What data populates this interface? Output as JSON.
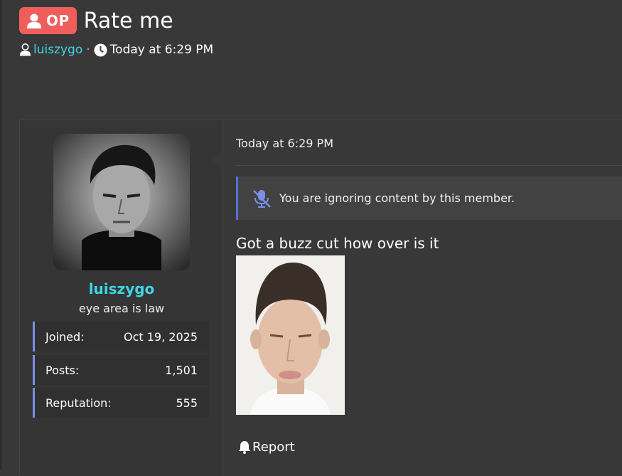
{
  "thread": {
    "badge": "OP",
    "title": "Rate me",
    "author": "luiszygo",
    "separator": "·",
    "date": "Today at 6:29 PM"
  },
  "post": {
    "user": {
      "name": "luiszygo",
      "title": "eye area is law",
      "stats": [
        {
          "label": "Joined:",
          "value": "Oct 19, 2025"
        },
        {
          "label": "Posts:",
          "value": "1,501"
        },
        {
          "label": "Reputation:",
          "value": "555"
        }
      ]
    },
    "date": "Today at 6:29 PM",
    "ignore_notice": "You are ignoring content by this member.",
    "body_text": "Got a buzz cut how over is it",
    "report_label": "Report"
  },
  "colors": {
    "background": "#383838",
    "op_badge": "#ef5e5b",
    "username": "#3fd6e6",
    "stat_accent": "#7b8fe8",
    "ignore_accent": "#5b6fd6"
  },
  "icons": [
    "user-icon",
    "clock-icon",
    "muted-microphone-icon",
    "bell-icon"
  ]
}
